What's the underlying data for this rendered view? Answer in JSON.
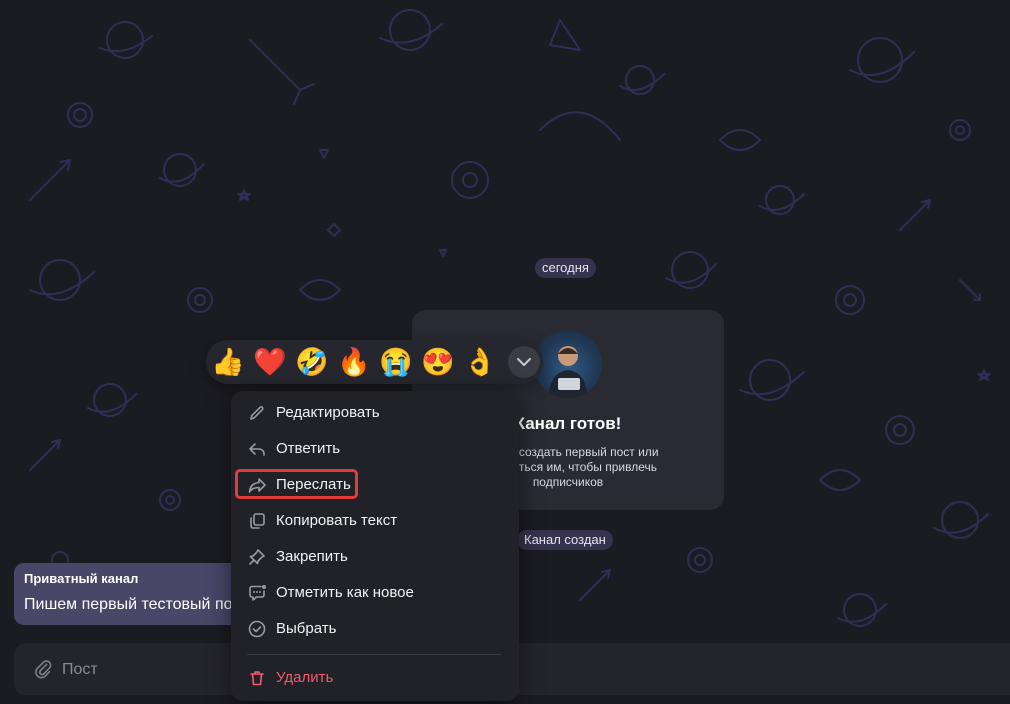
{
  "chat": {
    "date_label": "сегодня",
    "service_label": "Канал создан"
  },
  "card": {
    "title": "Канал готов!",
    "text": "Можно создать первый пост или поделиться им, чтобы привлечь подписчиков"
  },
  "message": {
    "sender": "Приватный канал",
    "text": "Пишем первый тестовый пост"
  },
  "composer": {
    "placeholder": "Пост"
  },
  "reactions": [
    "👍",
    "❤️",
    "🤣",
    "🔥",
    "😭",
    "😍",
    "👌"
  ],
  "context_menu": {
    "items": [
      {
        "label": "Редактировать",
        "icon": "pencil-icon"
      },
      {
        "label": "Ответить",
        "icon": "reply-icon"
      },
      {
        "label": "Переслать",
        "icon": "forward-icon",
        "highlighted": true
      },
      {
        "label": "Копировать текст",
        "icon": "copy-icon"
      },
      {
        "label": "Закрепить",
        "icon": "pin-icon"
      },
      {
        "label": "Отметить как новое",
        "icon": "mark-unread-icon"
      },
      {
        "label": "Выбрать",
        "icon": "check-circle-icon"
      },
      {
        "label": "Удалить",
        "icon": "trash-icon",
        "danger": true
      }
    ]
  },
  "colors": {
    "background": "#1b1b22",
    "wallpaper_doodles": "#2f2f55",
    "highlight": "#e23c3c",
    "danger": "#ef5b6f",
    "bubble": "#4a4668"
  }
}
